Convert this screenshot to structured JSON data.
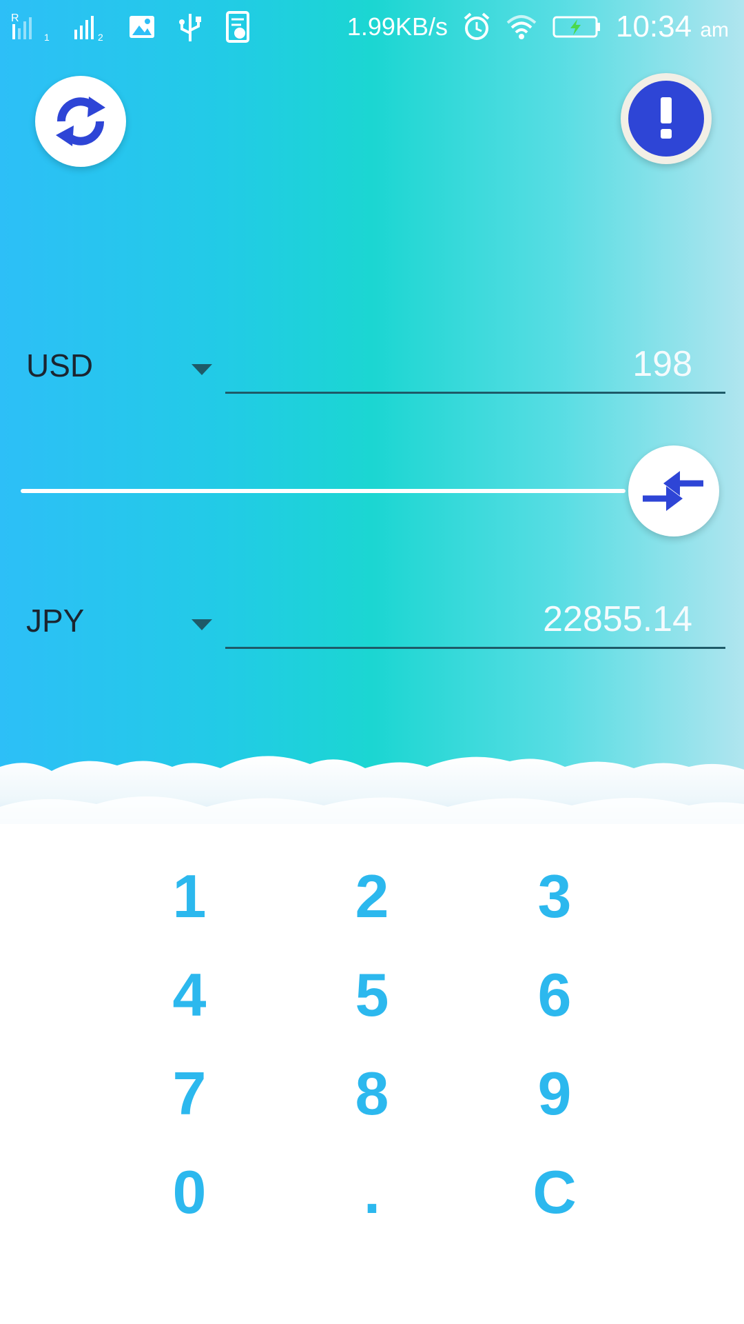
{
  "status_bar": {
    "net_speed": "1.99KB/s",
    "time": "10:34",
    "time_suffix": "am",
    "sim1": "1",
    "sim2": "2",
    "roaming": "R"
  },
  "top": {
    "refresh_icon": "refresh-icon",
    "info_icon": "exclamation-icon"
  },
  "from": {
    "currency": "USD",
    "amount": "198"
  },
  "to": {
    "currency": "JPY",
    "amount": "22855.14"
  },
  "swap_icon": "swap-arrows-icon",
  "keypad": {
    "keys": [
      "1",
      "2",
      "3",
      "4",
      "5",
      "6",
      "7",
      "8",
      "9",
      "0",
      ".",
      "C"
    ]
  },
  "colors": {
    "accent_blue": "#2e45d6",
    "key_color": "#2cb8ee"
  }
}
